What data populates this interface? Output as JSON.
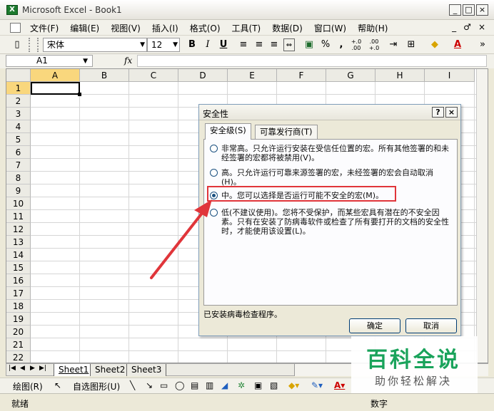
{
  "window": {
    "title": "Microsoft Excel - Book1",
    "controls": [
      "_",
      "□",
      "×"
    ]
  },
  "menu": {
    "items": [
      "文件(F)",
      "编辑(E)",
      "视图(V)",
      "插入(I)",
      "格式(O)",
      "工具(T)",
      "数据(D)",
      "窗口(W)",
      "帮助(H)"
    ],
    "doc_controls": [
      "_",
      "♂",
      "×"
    ]
  },
  "toolbar": {
    "font_name": "宋体",
    "font_size": "12",
    "bold": "B",
    "italic": "I",
    "underline": "U",
    "percent": "%",
    "comma": ",",
    "inc_decimal": "+.0 .00",
    "dec_decimal": ".00 +.0"
  },
  "formula_bar": {
    "name_box": "A1",
    "fx": "fx",
    "value": ""
  },
  "grid": {
    "columns": [
      "A",
      "B",
      "C",
      "D",
      "E",
      "F",
      "G",
      "H",
      "I"
    ],
    "rows": [
      "1",
      "2",
      "3",
      "4",
      "5",
      "6",
      "7",
      "8",
      "9",
      "10",
      "11",
      "12",
      "13",
      "14",
      "15",
      "16",
      "17",
      "18",
      "19",
      "20",
      "21",
      "22"
    ],
    "active_column": "A",
    "active_row": "1"
  },
  "sheets": {
    "tabs": [
      "Sheet1",
      "Sheet2",
      "Sheet3"
    ],
    "active": "Sheet1"
  },
  "draw_toolbar": {
    "draw_label": "绘图(R)",
    "autoshape_label": "自选图形(U)"
  },
  "status": {
    "left": "就绪",
    "mode": "数字"
  },
  "dialog": {
    "title": "安全性",
    "title_buttons": [
      "?",
      "×"
    ],
    "tabs": [
      "安全级(S)",
      "可靠发行商(T)"
    ],
    "active_tab": "安全级(S)",
    "options": [
      {
        "text": "非常高。只允许运行安装在受信任位置的宏。所有其他签署的和未经签署的宏都将被禁用(V)。",
        "selected": false
      },
      {
        "text": "高。只允许运行可靠来源签署的宏，未经签署的宏会自动取消(H)。",
        "selected": false
      },
      {
        "text": "中。您可以选择是否运行可能不安全的宏(M)。",
        "selected": true
      },
      {
        "text": "低(不建议使用)。您将不受保护，而某些宏具有潜在的不安全因素。只有在安装了防病毒软件或检查了所有要打开的文档的安全性时，才能使用该设置(L)。",
        "selected": false
      }
    ],
    "footer": "已安装病毒检查程序。",
    "ok_label": "确定",
    "cancel_label": "取消"
  },
  "annotation": {
    "highlight_color": "#e0353a",
    "arrow_color": "#e0353a"
  },
  "watermark": {
    "main": "百科全说",
    "sub": "助你轻松解决",
    "color": "#1aa35b"
  }
}
